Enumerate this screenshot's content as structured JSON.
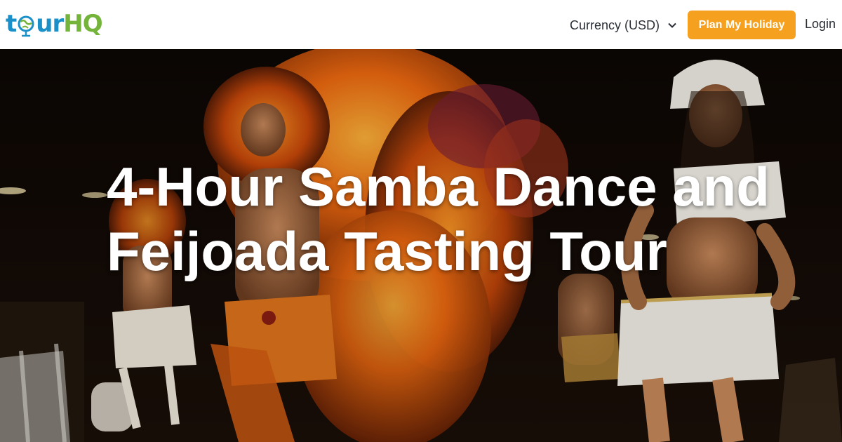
{
  "brand": {
    "logo_part1": "t",
    "logo_part2": "ur",
    "logo_part3": "HQ",
    "colors": {
      "blue": "#1b8fc8",
      "green": "#74b43a"
    }
  },
  "nav": {
    "currency_label": "Currency (USD)",
    "currency_icon": "chevron-down-icon",
    "plan_button": "Plan My Holiday",
    "login": "Login",
    "accent_color": "#f5a11f"
  },
  "hero": {
    "title_line1": "4-Hour Samba Dance and",
    "title_line2": "Feijoada Tasting Tour"
  }
}
